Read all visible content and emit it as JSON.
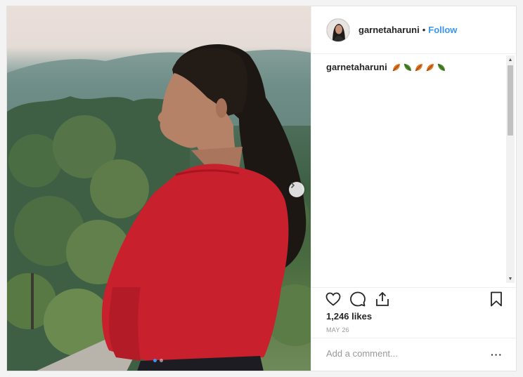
{
  "post": {
    "username": "garnetaharuni",
    "separator": "•",
    "follow_label": "Follow",
    "caption": {
      "username": "garnetaharuni",
      "emoji": [
        "fallen-leaf-orange",
        "leaf-green",
        "fallen-leaf-orange",
        "fallen-leaf-orange",
        "leaf-green"
      ]
    },
    "likes": "1,246 likes",
    "date": "MAY 26",
    "comment_placeholder": "Add a comment...",
    "more_label": "···",
    "carousel": {
      "current": 1,
      "total": 2
    }
  },
  "icons": {
    "like": "heart-icon",
    "comment": "comment-bubble-icon",
    "share": "share-icon",
    "save": "bookmark-icon",
    "next": "chevron-right-icon"
  },
  "colors": {
    "accent": "#3897f0",
    "text": "#262626",
    "muted": "#999999",
    "sweater": "#c8202d"
  }
}
